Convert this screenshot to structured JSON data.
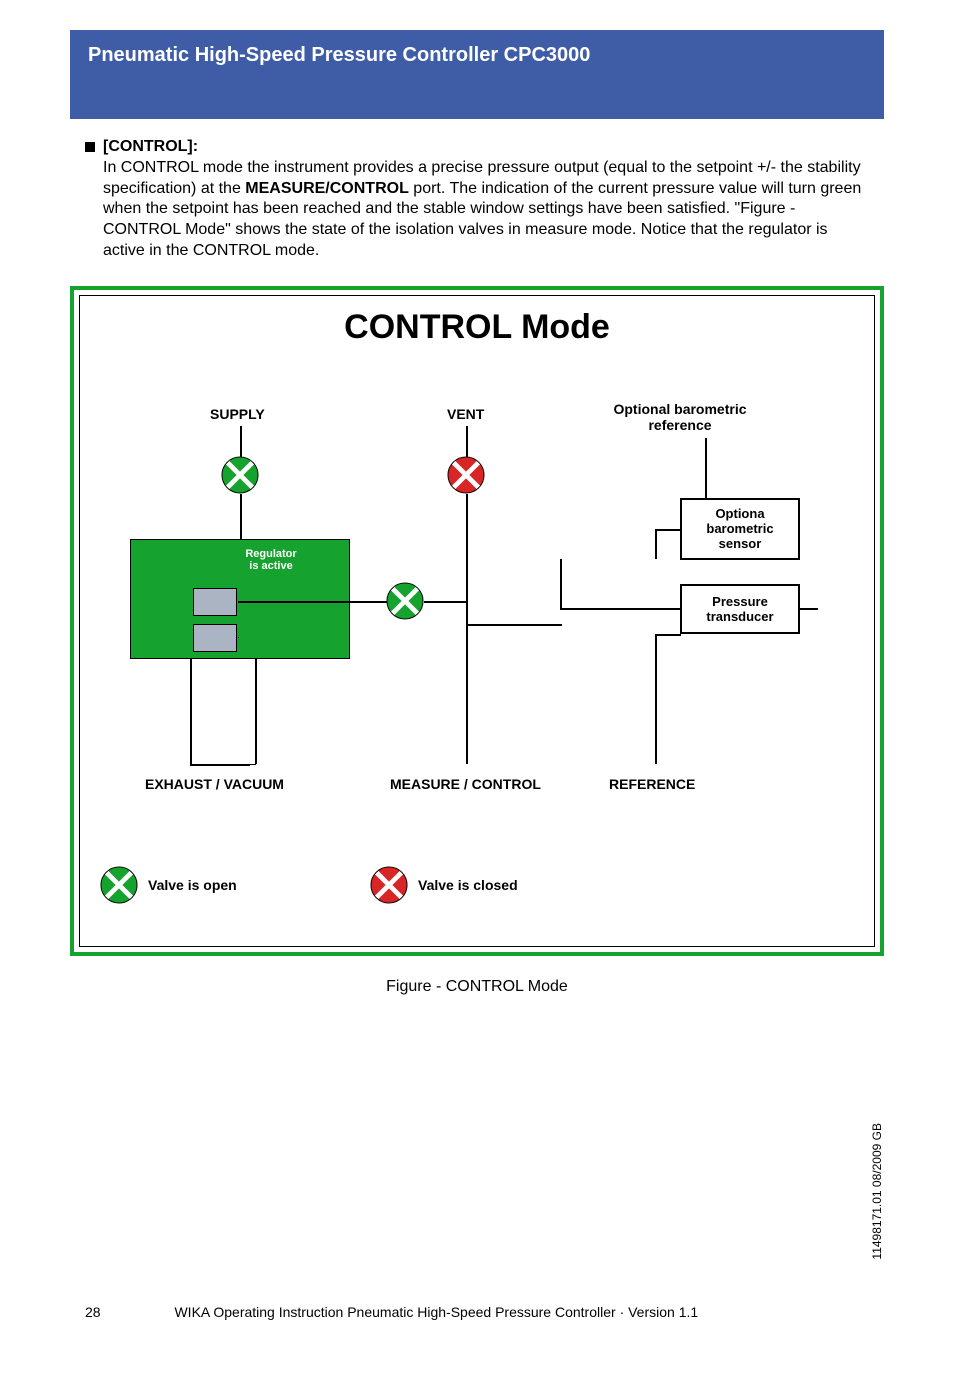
{
  "header_title": "Pneumatic High-Speed Pressure Controller CPC3000",
  "section": {
    "bullet_label": "[CONTROL]:",
    "paragraph_before_bold": "In CONTROL mode the instrument provides a precise pressure output (equal to the setpoint +/- the stability specification) at the ",
    "paragraph_bold": "MEASURE/CONTROL",
    "paragraph_after_bold": " port. The indication of the current pressure value will turn green when the setpoint has been reached and the stable window settings have been satisfied. \"Figure - CONTROL Mode\" shows the state of the isolation valves in measure mode. Notice that the regulator is active in the CONTROL mode."
  },
  "diagram": {
    "title": "CONTROL Mode",
    "labels": {
      "supply": "SUPPLY",
      "vent": "VENT",
      "optional_baro_ref": "Optional barometric reference",
      "optional_baro_sensor": "Optiona barometric sensor",
      "pressure_transducer": "Pressure transducer",
      "exhaust_vacuum": "EXHAUST / VACUUM",
      "measure_control": "MEASURE / CONTROL",
      "reference": "REFERENCE",
      "regulator_active": "Regulator\nis active",
      "valve_open": "Valve is open",
      "valve_closed": "Valve is closed"
    },
    "valves": {
      "supply": "open",
      "vent": "closed",
      "measure": "open",
      "legend_open": "open",
      "legend_closed": "closed"
    }
  },
  "figure_caption": "Figure - CONTROL Mode",
  "side_text": "11498171.01 08/2009  GB",
  "footer": {
    "page": "28",
    "text": "WIKA Operating Instruction Pneumatic High-Speed Pressure Controller · Version 1.1"
  }
}
